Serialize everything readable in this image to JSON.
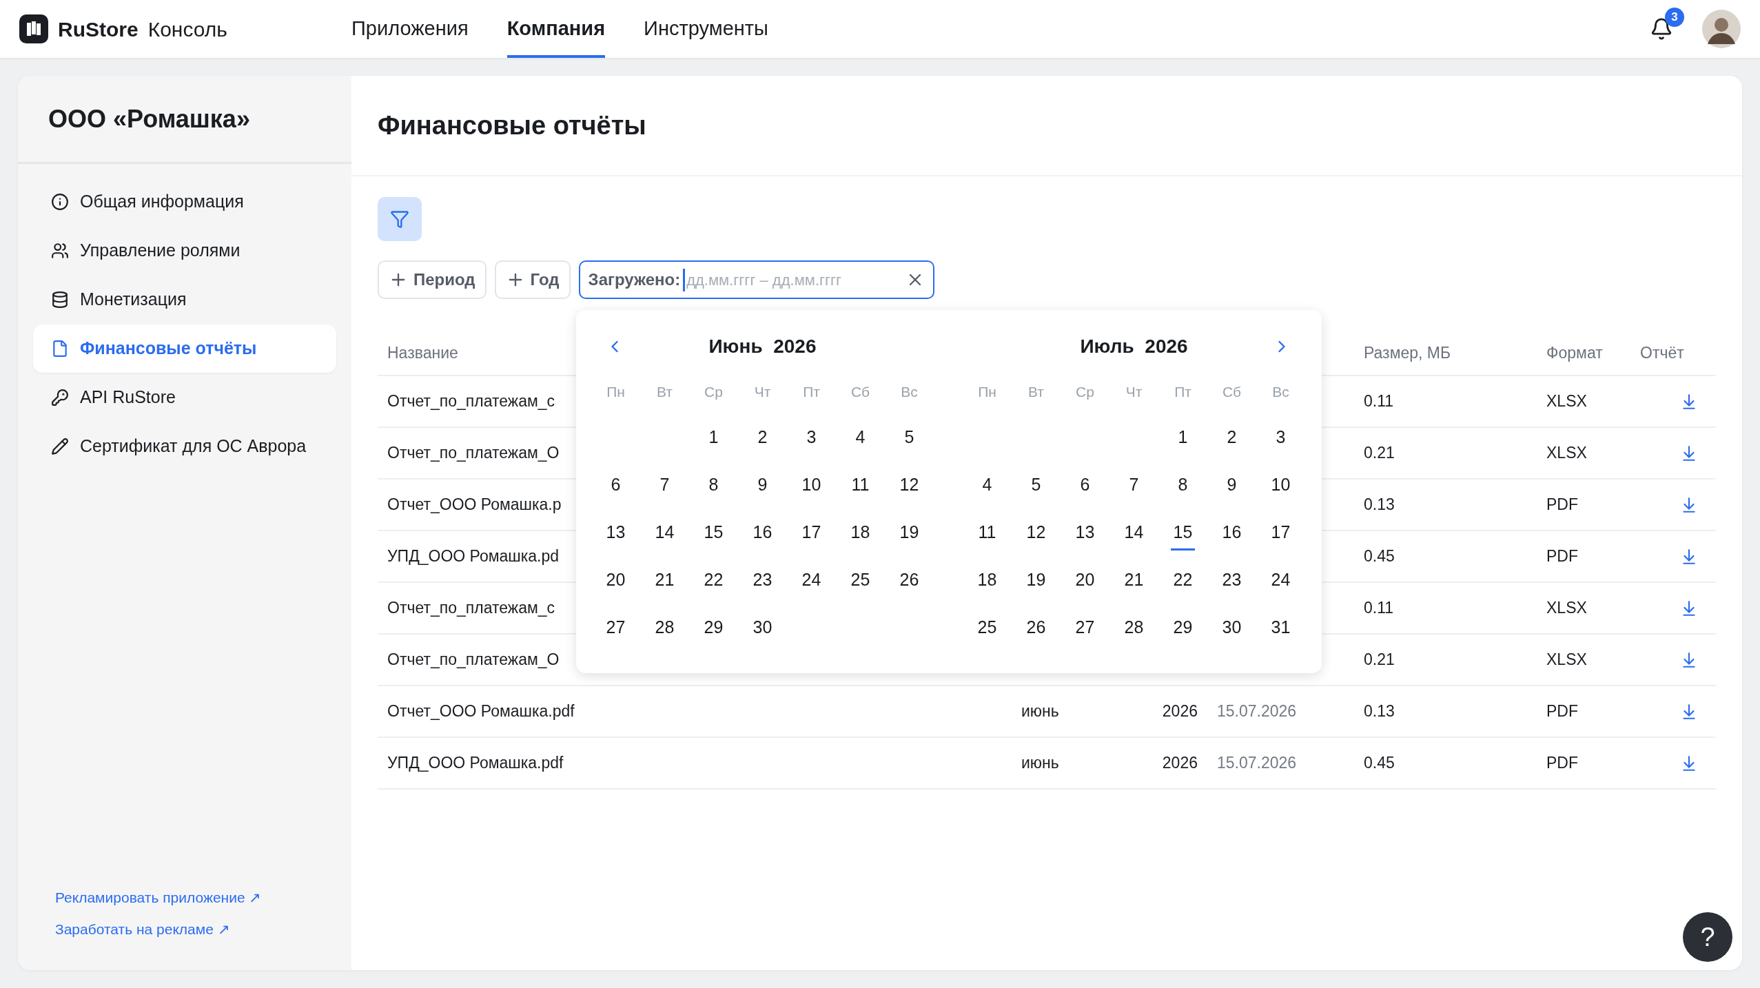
{
  "header": {
    "logo": "RuStore",
    "product": "Консоль",
    "nav": [
      {
        "label": "Приложения",
        "selected": false
      },
      {
        "label": "Компания",
        "selected": true
      },
      {
        "label": "Инструменты",
        "selected": false
      }
    ],
    "notifications": "3"
  },
  "sidebar": {
    "title": "ООО «Ромашка»",
    "items": [
      {
        "label": "Общая информация",
        "selected": false
      },
      {
        "label": "Управление ролями",
        "selected": false
      },
      {
        "label": "Монетизация",
        "selected": false
      },
      {
        "label": "Финансовые отчёты",
        "selected": true
      },
      {
        "label": "API RuStore",
        "selected": false
      },
      {
        "label": "Сертификат для ОС Аврора",
        "selected": false
      }
    ],
    "links": [
      "Рекламировать приложение ↗",
      "Заработать на рекламе ↗"
    ]
  },
  "main": {
    "title": "Финансовые отчёты",
    "chips": [
      "Период",
      "Год"
    ],
    "date_filter": {
      "label": "Загружено:",
      "placeholder": "дд.мм.гггг – дд.мм.гггг"
    }
  },
  "table": {
    "columns": [
      "Название",
      "Размер, МБ",
      "Формат",
      "Отчёт"
    ],
    "rows": [
      {
        "name": "Отчет_по_платежам_с",
        "size": "0.11",
        "format": "XLSX"
      },
      {
        "name": "Отчет_по_платежам_О",
        "size": "0.21",
        "format": "XLSX"
      },
      {
        "name": "Отчет_ООО Ромашка.p",
        "size": "0.13",
        "format": "PDF"
      },
      {
        "name": "УПД_ООО Ромашка.pd",
        "size": "0.45",
        "format": "PDF"
      },
      {
        "name": "Отчет_по_платежам_с",
        "size": "0.11",
        "format": "XLSX"
      },
      {
        "name": "Отчет_по_платежам_О",
        "size": "0.21",
        "format": "XLSX"
      },
      {
        "name": "Отчет_ООО Ромашка.pdf",
        "month": "июнь",
        "year": "2026",
        "date": "15.07.2026",
        "size": "0.13",
        "format": "PDF"
      },
      {
        "name": "УПД_ООО Ромашка.pdf",
        "month": "июнь",
        "year": "2026",
        "date": "15.07.2026",
        "size": "0.45",
        "format": "PDF"
      }
    ]
  },
  "calendar": {
    "months": [
      {
        "title": "Июнь  2026",
        "weekdays": [
          "Пн",
          "Вт",
          "Ср",
          "Чт",
          "Пт",
          "Сб",
          "Вс"
        ],
        "weeks": [
          [
            {
              "d": "1",
              "today": false
            },
            {
              "d": "2",
              "today": false
            },
            {
              "d": "3",
              "today": false
            },
            {
              "d": "4",
              "today": false
            },
            {
              "d": "5",
              "today": false
            }
          ],
          [
            {
              "d": "6",
              "today": false
            },
            {
              "d": "7",
              "today": false
            },
            {
              "d": "8",
              "today": false
            },
            {
              "d": "9",
              "today": false
            },
            {
              "d": "10",
              "today": false
            },
            {
              "d": "11",
              "today": false
            },
            {
              "d": "12",
              "today": false
            }
          ],
          [
            {
              "d": "13",
              "today": false
            },
            {
              "d": "14",
              "today": false
            },
            {
              "d": "15",
              "today": false
            },
            {
              "d": "16",
              "today": false
            },
            {
              "d": "17",
              "today": false
            },
            {
              "d": "18",
              "today": false
            },
            {
              "d": "19",
              "today": false
            }
          ],
          [
            {
              "d": "20",
              "today": false
            },
            {
              "d": "21",
              "today": false
            },
            {
              "d": "22",
              "today": false
            },
            {
              "d": "23",
              "today": false
            },
            {
              "d": "24",
              "today": false
            },
            {
              "d": "25",
              "today": false
            },
            {
              "d": "26",
              "today": false
            }
          ],
          [
            {
              "d": "27",
              "today": false
            },
            {
              "d": "28",
              "today": false
            },
            {
              "d": "29",
              "today": false
            },
            {
              "d": "30",
              "today": false
            }
          ]
        ]
      },
      {
        "title": "Июль  2026",
        "weekdays": [
          "Пн",
          "Вт",
          "Ср",
          "Чт",
          "Пт",
          "Сб",
          "Вс"
        ],
        "weeks": [
          [
            {
              "d": "1",
              "today": false
            },
            {
              "d": "2",
              "today": false
            },
            {
              "d": "3",
              "today": false
            }
          ],
          [
            {
              "d": "4",
              "today": false
            },
            {
              "d": "5",
              "today": false
            },
            {
              "d": "6",
              "today": false
            },
            {
              "d": "7",
              "today": false
            },
            {
              "d": "8",
              "today": false
            },
            {
              "d": "9",
              "today": false
            },
            {
              "d": "10",
              "today": false
            }
          ],
          [
            {
              "d": "11",
              "today": false
            },
            {
              "d": "12",
              "today": false
            },
            {
              "d": "13",
              "today": false
            },
            {
              "d": "14",
              "today": false
            },
            {
              "d": "15",
              "today": true
            },
            {
              "d": "16",
              "today": false
            },
            {
              "d": "17",
              "today": false
            }
          ],
          [
            {
              "d": "18",
              "today": false
            },
            {
              "d": "19",
              "today": false
            },
            {
              "d": "20",
              "today": false
            },
            {
              "d": "21",
              "today": false
            },
            {
              "d": "22",
              "today": false
            },
            {
              "d": "23",
              "today": false
            },
            {
              "d": "24",
              "today": false
            }
          ],
          [
            {
              "d": "25",
              "today": false
            },
            {
              "d": "26",
              "today": false
            },
            {
              "d": "27",
              "today": false
            },
            {
              "d": "28",
              "today": false
            },
            {
              "d": "29",
              "today": false
            },
            {
              "d": "30",
              "today": false
            },
            {
              "d": "31",
              "today": false
            }
          ]
        ]
      }
    ]
  },
  "help": "?"
}
